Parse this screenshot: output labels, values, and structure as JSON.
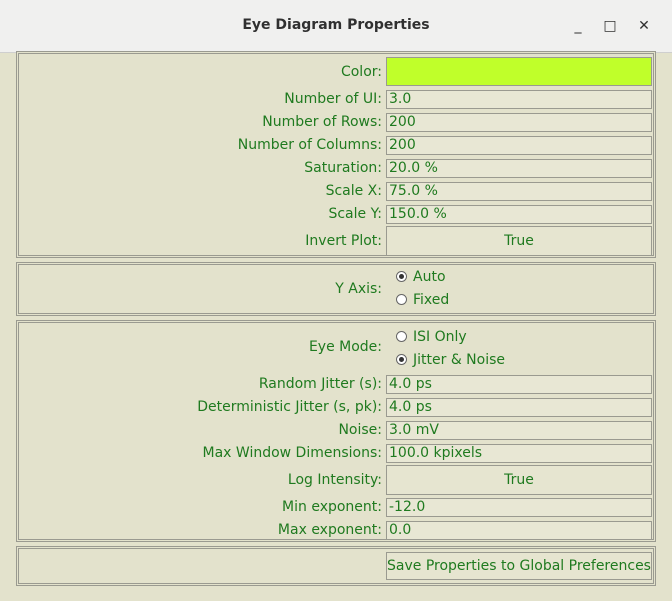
{
  "window": {
    "title": "Eye Diagram Properties",
    "min_icon": "_",
    "max_icon": "□",
    "close_icon": "✕"
  },
  "colors": {
    "label_green": "#1f7a1f",
    "swatch": "#c0ff2a"
  },
  "general": {
    "color_label": "Color:",
    "ui_label": "Number of UI:",
    "ui_value": "3.0",
    "rows_label": "Number of Rows:",
    "rows_value": "200",
    "cols_label": "Number of Columns:",
    "cols_value": "200",
    "sat_label": "Saturation:",
    "sat_value": "20.0 %",
    "scalex_label": "Scale X:",
    "scalex_value": "75.0 %",
    "scaley_label": "Scale Y:",
    "scaley_value": "150.0 %",
    "invert_label": "Invert Plot:",
    "invert_value": "True"
  },
  "yaxis": {
    "label": "Y Axis:",
    "options": [
      {
        "label": "Auto",
        "selected": true
      },
      {
        "label": "Fixed",
        "selected": false
      }
    ]
  },
  "eye": {
    "mode_label": "Eye Mode:",
    "modes": [
      {
        "label": "ISI Only",
        "selected": false
      },
      {
        "label": "Jitter & Noise",
        "selected": true
      }
    ],
    "rj_label": "Random Jitter (s):",
    "rj_value": "4.0 ps",
    "dj_label": "Deterministic Jitter (s, pk):",
    "dj_value": "4.0 ps",
    "noise_label": "Noise:",
    "noise_value": "3.0 mV",
    "maxwin_label": "Max Window Dimensions:",
    "maxwin_value": "100.0 kpixels",
    "logint_label": "Log Intensity:",
    "logint_value": "True",
    "minexp_label": "Min exponent:",
    "minexp_value": "-12.0",
    "maxexp_label": "Max exponent:",
    "maxexp_value": "0.0"
  },
  "footer": {
    "save_label": "Save Properties to Global Preferences"
  }
}
